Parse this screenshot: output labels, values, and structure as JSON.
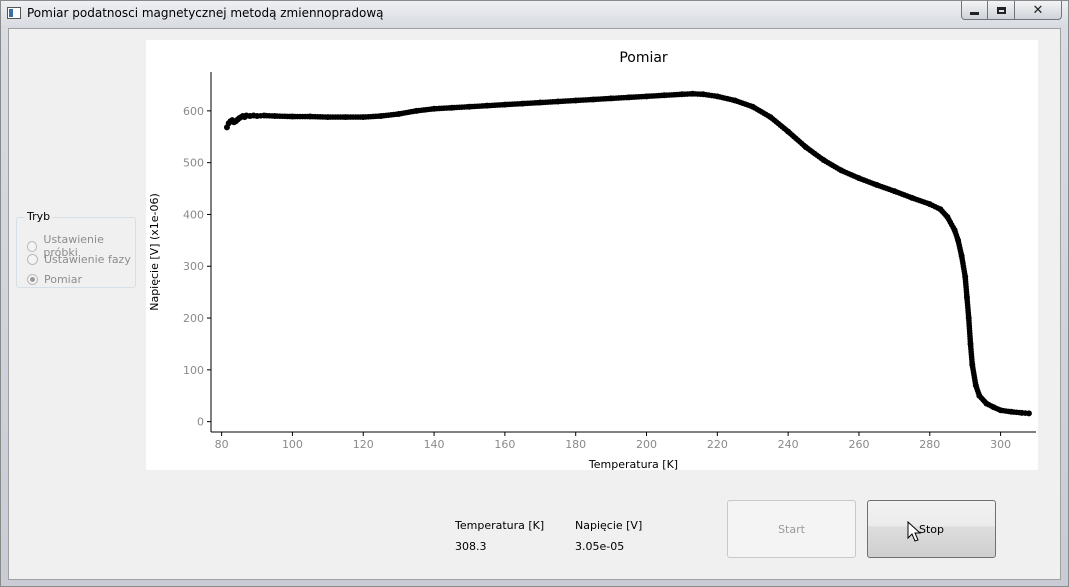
{
  "window": {
    "title": "Pomiar podatnosci magnetycznej metodą zmiennopradową",
    "buttons": [
      "minimize-icon",
      "maximize-icon",
      "close-icon"
    ]
  },
  "mode": {
    "title": "Tryb",
    "options": [
      {
        "label": "Ustawienie próbki",
        "checked": false
      },
      {
        "label": "Ustawienie fazy",
        "checked": false
      },
      {
        "label": "Pomiar",
        "checked": true
      }
    ]
  },
  "readouts": {
    "temperature_label": "Temperatura [K]",
    "temperature_value": "308.3",
    "voltage_label": "Napięcie [V]",
    "voltage_value": "3.05e-05"
  },
  "buttons": {
    "start": "Start",
    "stop": "Stop"
  },
  "chart_data": {
    "type": "scatter",
    "title": "Pomiar",
    "xlabel": "Temperatura [K]",
    "ylabel": "Napięcie [V] (x1e-06)",
    "xlim": [
      77,
      310
    ],
    "ylim": [
      -20,
      675
    ],
    "xticks": [
      80,
      100,
      120,
      140,
      160,
      180,
      200,
      220,
      240,
      260,
      280,
      300
    ],
    "yticks": [
      0,
      100,
      200,
      300,
      400,
      500,
      600
    ],
    "grid": false,
    "series_color": "#000000",
    "points": [
      [
        81.5,
        568
      ],
      [
        82,
        576
      ],
      [
        82.5,
        580
      ],
      [
        83,
        582
      ],
      [
        83.5,
        578
      ],
      [
        84,
        580
      ],
      [
        84.5,
        583
      ],
      [
        85,
        586
      ],
      [
        85.5,
        588
      ],
      [
        86,
        590
      ],
      [
        86.5,
        588
      ],
      [
        87,
        591
      ],
      [
        88,
        590
      ],
      [
        89,
        591
      ],
      [
        90,
        590
      ],
      [
        92,
        591
      ],
      [
        95,
        590
      ],
      [
        100,
        589
      ],
      [
        105,
        589
      ],
      [
        110,
        588
      ],
      [
        115,
        588
      ],
      [
        120,
        588
      ],
      [
        125,
        590
      ],
      [
        130,
        594
      ],
      [
        135,
        600
      ],
      [
        140,
        604
      ],
      [
        145,
        606
      ],
      [
        150,
        608
      ],
      [
        155,
        610
      ],
      [
        160,
        612
      ],
      [
        165,
        614
      ],
      [
        170,
        616
      ],
      [
        175,
        618
      ],
      [
        180,
        620
      ],
      [
        185,
        622
      ],
      [
        190,
        624
      ],
      [
        195,
        626
      ],
      [
        200,
        628
      ],
      [
        205,
        630
      ],
      [
        210,
        632
      ],
      [
        213,
        633
      ],
      [
        216,
        632
      ],
      [
        220,
        628
      ],
      [
        225,
        620
      ],
      [
        230,
        608
      ],
      [
        235,
        588
      ],
      [
        240,
        560
      ],
      [
        245,
        530
      ],
      [
        250,
        505
      ],
      [
        255,
        485
      ],
      [
        260,
        470
      ],
      [
        265,
        457
      ],
      [
        270,
        445
      ],
      [
        275,
        432
      ],
      [
        280,
        420
      ],
      [
        283,
        410
      ],
      [
        285,
        395
      ],
      [
        287,
        370
      ],
      [
        288,
        350
      ],
      [
        289,
        320
      ],
      [
        290,
        280
      ],
      [
        290.5,
        240
      ],
      [
        291,
        200
      ],
      [
        291.5,
        150
      ],
      [
        292,
        110
      ],
      [
        293,
        70
      ],
      [
        294,
        50
      ],
      [
        296,
        35
      ],
      [
        298,
        28
      ],
      [
        300,
        22
      ],
      [
        303,
        19
      ],
      [
        306,
        17
      ],
      [
        308,
        16
      ]
    ]
  }
}
